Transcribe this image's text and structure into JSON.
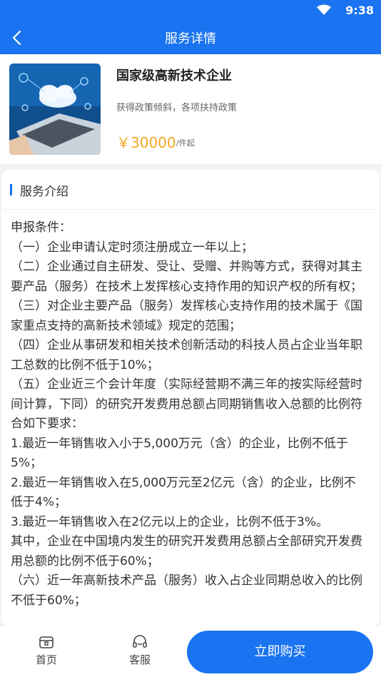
{
  "status_bar": {
    "time": "9:38"
  },
  "header": {
    "title": "服务详情"
  },
  "product": {
    "name": "国家级高新技术企业",
    "description": "获得政策倾斜，各项扶持政策",
    "price": "￥30000",
    "price_unit": "/件起"
  },
  "intro": {
    "title": "服务介绍",
    "paragraphs": [
      "申报条件：",
      "（一）企业申请认定时须注册成立一年以上；",
      "（二）企业通过自主研发、受让、受赠、并购等方式，获得对其主要产品（服务）在技术上发挥核心支持作用的知识产权的所有权；",
      "（三）对企业主要产品（服务）发挥核心支持作用的技术属于《国家重点支持的高新技术领域》规定的范围；",
      "（四）企业从事研发和相关技术创新活动的科技人员占企业当年职工总数的比例不低于10%；",
      "（五）企业近三个会计年度（实际经营期不满三年的按实际经营时间计算，下同）的研究开发费用总额占同期销售收入总额的比例符合如下要求：",
      "1.最近一年销售收入小于5,000万元（含）的企业，比例不低于5%；",
      "2.最近一年销售收入在5,000万元至2亿元（含）的企业，比例不低于4%；",
      "3.最近一年销售收入在2亿元以上的企业，比例不低于3%。",
      "其中，企业在中国境内发生的研究开发费用总额占全部研究开发费用总额的比例不低于60%；",
      "（六）近一年高新技术产品（服务）收入占企业同期总收入的比例不低于60%；"
    ]
  },
  "bottom_nav": {
    "home_label": "首页",
    "service_label": "客服",
    "buy_label": "立即购买"
  },
  "colors": {
    "primary": "#1a73f0",
    "price": "#f5a623"
  }
}
